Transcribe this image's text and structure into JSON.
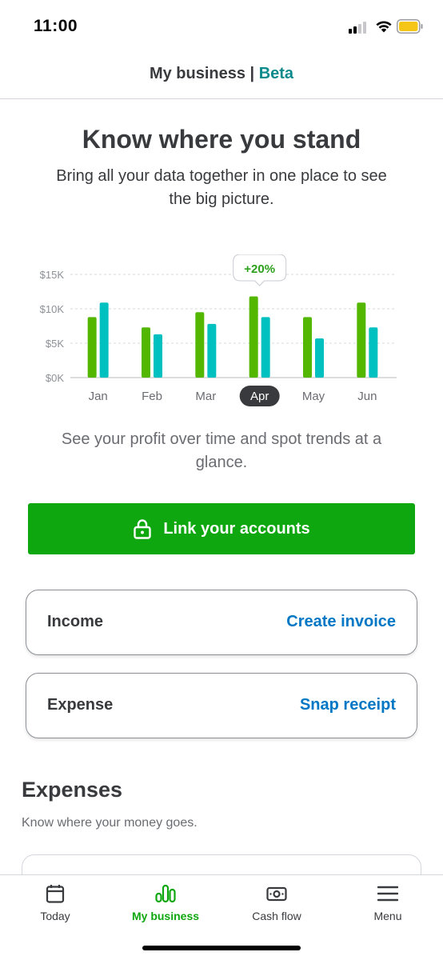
{
  "status_bar": {
    "time": "11:00",
    "icons": [
      "cellular-signal-icon",
      "wifi-icon",
      "battery-icon"
    ],
    "battery_color": "#f5c518"
  },
  "header": {
    "title": "My business",
    "separator": " | ",
    "badge": "Beta"
  },
  "hero": {
    "title": "Know where you stand",
    "subtitle": "Bring all your data together in one place to see the big picture."
  },
  "chart_data": {
    "type": "bar",
    "categories": [
      "Jan",
      "Feb",
      "Mar",
      "Apr",
      "May",
      "Jun"
    ],
    "series": [
      {
        "color": "#53b700",
        "values": [
          8.8,
          7.3,
          9.5,
          11.8,
          8.8,
          10.9
        ]
      },
      {
        "color": "#00c1bf",
        "values": [
          10.9,
          6.3,
          7.8,
          8.8,
          5.7,
          7.3
        ]
      }
    ],
    "y_ticks": [
      "$0K",
      "$5K",
      "$10K",
      "$15K"
    ],
    "ylim": [
      0,
      15
    ],
    "selected_category": "Apr",
    "callout": "+20%",
    "grid": true
  },
  "chart_caption": "See your profit over time and spot trends at a glance.",
  "cta": {
    "label": "Link your accounts",
    "icon": "lock-icon",
    "color": "#0ea70f"
  },
  "cards": [
    {
      "label": "Income",
      "action": "Create invoice"
    },
    {
      "label": "Expense",
      "action": "Snap receipt"
    }
  ],
  "expenses": {
    "title": "Expenses",
    "subtitle": "Know where your money goes."
  },
  "tab_bar": {
    "tabs": [
      {
        "label": "Today",
        "icon": "calendar-icon",
        "active": false
      },
      {
        "label": "My business",
        "icon": "bar-chart-icon",
        "active": true
      },
      {
        "label": "Cash flow",
        "icon": "cash-icon",
        "active": false
      },
      {
        "label": "Menu",
        "icon": "hamburger-menu-icon",
        "active": false
      }
    ],
    "active_color": "#0ea70f"
  }
}
